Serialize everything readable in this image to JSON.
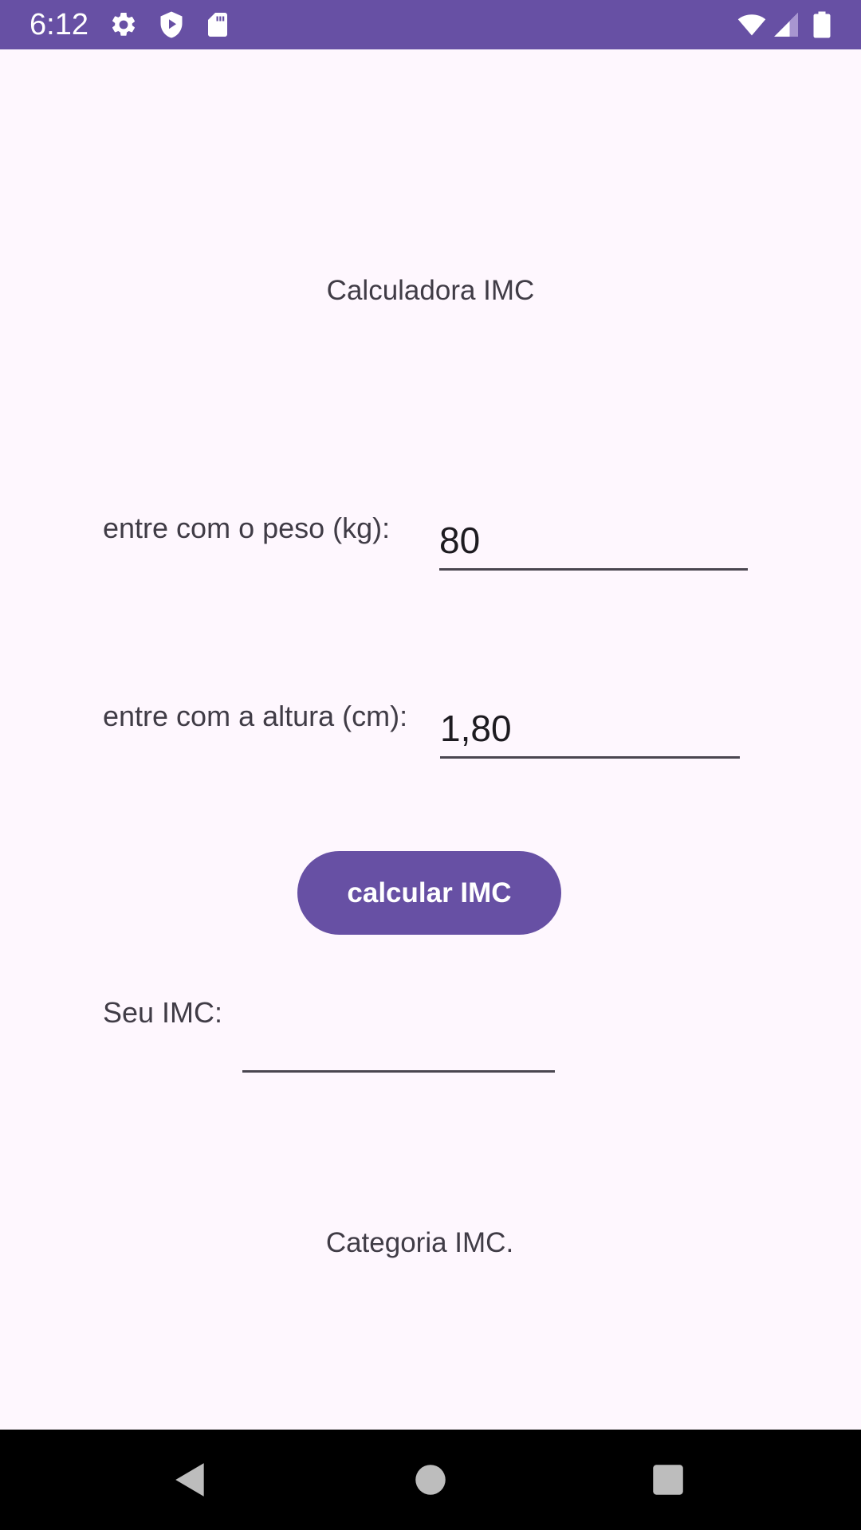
{
  "status_bar": {
    "time": "6:12",
    "icons": [
      "gear-icon",
      "shield-play-icon",
      "sd-card-icon",
      "wifi-icon",
      "signal-icon",
      "battery-icon"
    ]
  },
  "main": {
    "title": "Calculadora IMC",
    "weight": {
      "label": "entre com o peso (kg):",
      "value": "80"
    },
    "height": {
      "label": "entre com a altura (cm):",
      "value": "1,80"
    },
    "calc_button_label": "calcular IMC",
    "result": {
      "label": "Seu IMC:",
      "value": ""
    },
    "category_text": "Categoria IMC."
  },
  "nav_bar": {
    "icons": [
      "back-icon",
      "home-icon",
      "recents-icon"
    ]
  },
  "colors": {
    "accent": "#6750a4",
    "background": "#fef7fe",
    "text": "#403c46"
  }
}
